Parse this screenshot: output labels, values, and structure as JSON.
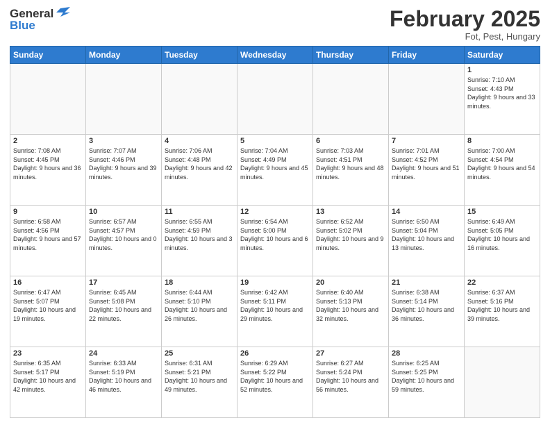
{
  "logo": {
    "line1": "General",
    "line2": "Blue"
  },
  "header": {
    "month": "February 2025",
    "location": "Fot, Pest, Hungary"
  },
  "days_of_week": [
    "Sunday",
    "Monday",
    "Tuesday",
    "Wednesday",
    "Thursday",
    "Friday",
    "Saturday"
  ],
  "weeks": [
    [
      {
        "day": "",
        "info": ""
      },
      {
        "day": "",
        "info": ""
      },
      {
        "day": "",
        "info": ""
      },
      {
        "day": "",
        "info": ""
      },
      {
        "day": "",
        "info": ""
      },
      {
        "day": "",
        "info": ""
      },
      {
        "day": "1",
        "info": "Sunrise: 7:10 AM\nSunset: 4:43 PM\nDaylight: 9 hours and 33 minutes."
      }
    ],
    [
      {
        "day": "2",
        "info": "Sunrise: 7:08 AM\nSunset: 4:45 PM\nDaylight: 9 hours and 36 minutes."
      },
      {
        "day": "3",
        "info": "Sunrise: 7:07 AM\nSunset: 4:46 PM\nDaylight: 9 hours and 39 minutes."
      },
      {
        "day": "4",
        "info": "Sunrise: 7:06 AM\nSunset: 4:48 PM\nDaylight: 9 hours and 42 minutes."
      },
      {
        "day": "5",
        "info": "Sunrise: 7:04 AM\nSunset: 4:49 PM\nDaylight: 9 hours and 45 minutes."
      },
      {
        "day": "6",
        "info": "Sunrise: 7:03 AM\nSunset: 4:51 PM\nDaylight: 9 hours and 48 minutes."
      },
      {
        "day": "7",
        "info": "Sunrise: 7:01 AM\nSunset: 4:52 PM\nDaylight: 9 hours and 51 minutes."
      },
      {
        "day": "8",
        "info": "Sunrise: 7:00 AM\nSunset: 4:54 PM\nDaylight: 9 hours and 54 minutes."
      }
    ],
    [
      {
        "day": "9",
        "info": "Sunrise: 6:58 AM\nSunset: 4:56 PM\nDaylight: 9 hours and 57 minutes."
      },
      {
        "day": "10",
        "info": "Sunrise: 6:57 AM\nSunset: 4:57 PM\nDaylight: 10 hours and 0 minutes."
      },
      {
        "day": "11",
        "info": "Sunrise: 6:55 AM\nSunset: 4:59 PM\nDaylight: 10 hours and 3 minutes."
      },
      {
        "day": "12",
        "info": "Sunrise: 6:54 AM\nSunset: 5:00 PM\nDaylight: 10 hours and 6 minutes."
      },
      {
        "day": "13",
        "info": "Sunrise: 6:52 AM\nSunset: 5:02 PM\nDaylight: 10 hours and 9 minutes."
      },
      {
        "day": "14",
        "info": "Sunrise: 6:50 AM\nSunset: 5:04 PM\nDaylight: 10 hours and 13 minutes."
      },
      {
        "day": "15",
        "info": "Sunrise: 6:49 AM\nSunset: 5:05 PM\nDaylight: 10 hours and 16 minutes."
      }
    ],
    [
      {
        "day": "16",
        "info": "Sunrise: 6:47 AM\nSunset: 5:07 PM\nDaylight: 10 hours and 19 minutes."
      },
      {
        "day": "17",
        "info": "Sunrise: 6:45 AM\nSunset: 5:08 PM\nDaylight: 10 hours and 22 minutes."
      },
      {
        "day": "18",
        "info": "Sunrise: 6:44 AM\nSunset: 5:10 PM\nDaylight: 10 hours and 26 minutes."
      },
      {
        "day": "19",
        "info": "Sunrise: 6:42 AM\nSunset: 5:11 PM\nDaylight: 10 hours and 29 minutes."
      },
      {
        "day": "20",
        "info": "Sunrise: 6:40 AM\nSunset: 5:13 PM\nDaylight: 10 hours and 32 minutes."
      },
      {
        "day": "21",
        "info": "Sunrise: 6:38 AM\nSunset: 5:14 PM\nDaylight: 10 hours and 36 minutes."
      },
      {
        "day": "22",
        "info": "Sunrise: 6:37 AM\nSunset: 5:16 PM\nDaylight: 10 hours and 39 minutes."
      }
    ],
    [
      {
        "day": "23",
        "info": "Sunrise: 6:35 AM\nSunset: 5:17 PM\nDaylight: 10 hours and 42 minutes."
      },
      {
        "day": "24",
        "info": "Sunrise: 6:33 AM\nSunset: 5:19 PM\nDaylight: 10 hours and 46 minutes."
      },
      {
        "day": "25",
        "info": "Sunrise: 6:31 AM\nSunset: 5:21 PM\nDaylight: 10 hours and 49 minutes."
      },
      {
        "day": "26",
        "info": "Sunrise: 6:29 AM\nSunset: 5:22 PM\nDaylight: 10 hours and 52 minutes."
      },
      {
        "day": "27",
        "info": "Sunrise: 6:27 AM\nSunset: 5:24 PM\nDaylight: 10 hours and 56 minutes."
      },
      {
        "day": "28",
        "info": "Sunrise: 6:25 AM\nSunset: 5:25 PM\nDaylight: 10 hours and 59 minutes."
      },
      {
        "day": "",
        "info": ""
      }
    ]
  ]
}
